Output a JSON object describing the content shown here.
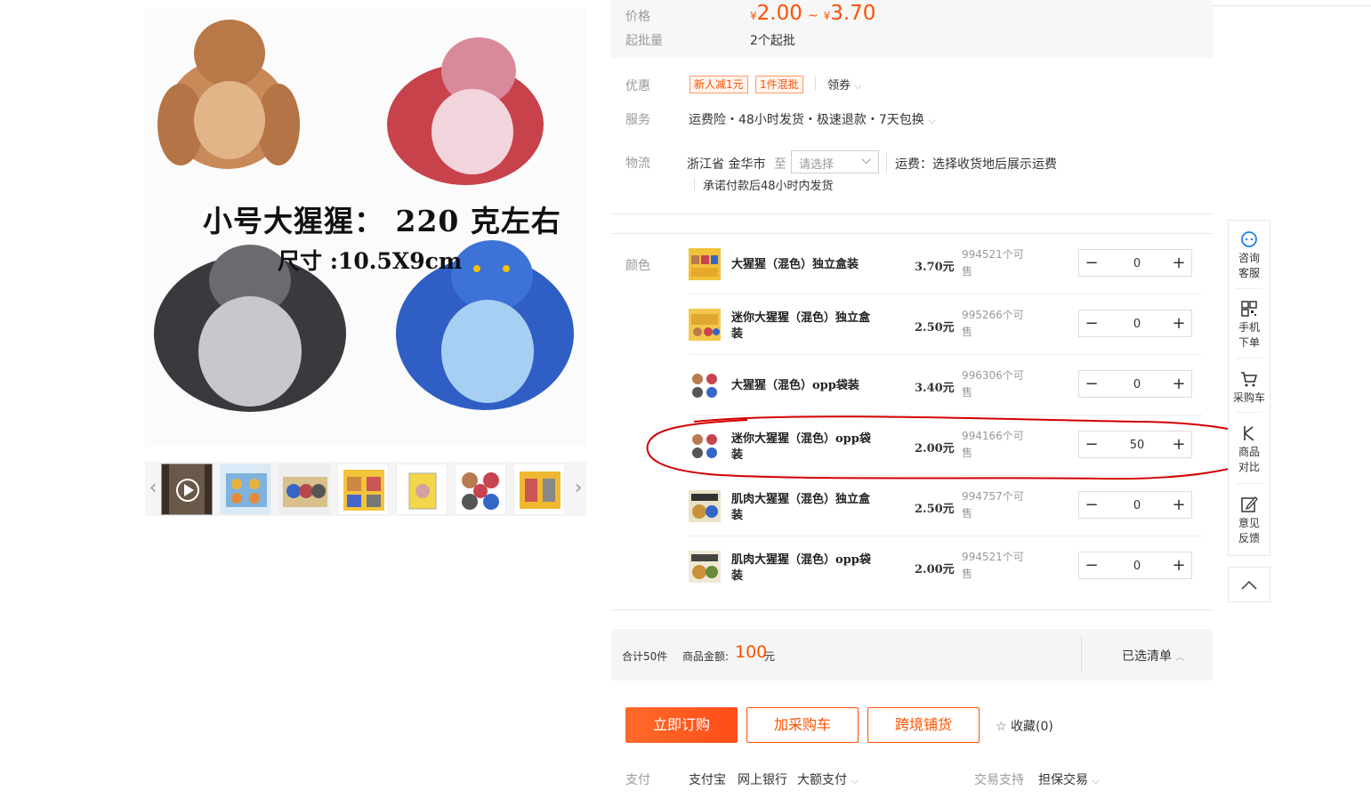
{
  "image": {
    "caption_line1": "小号大猩猩： 220 克左右",
    "caption_line2": "尺寸 :10.5X9cm"
  },
  "price": {
    "label": "价格",
    "currency": "¥",
    "min": "2.00",
    "tilde": "~",
    "max": "3.70",
    "min_batch_label": "起批量",
    "min_batch": "2个起批"
  },
  "promo": {
    "label": "优惠",
    "tags": [
      "新人减1元",
      "1件混批"
    ],
    "coupon": "领券"
  },
  "service": {
    "label": "服务",
    "text": "运费险・48小时发货・极速退款・7天包换"
  },
  "logistics": {
    "label": "物流",
    "origin": "浙江省 金华市",
    "to": "至",
    "select_placeholder": "请选择",
    "freight": "运费：选择收货地后展示运费",
    "promise": "承诺付款后48小时内发货"
  },
  "sku": {
    "label": "颜色",
    "rows": [
      {
        "name": "大猩猩（混色）独立盒装",
        "price": "3.70元",
        "stock": "994521个可售",
        "qty": "0"
      },
      {
        "name": "迷你大猩猩（混色）独立盒装",
        "price": "2.50元",
        "stock": "995266个可售",
        "qty": "0"
      },
      {
        "name": "大猩猩（混色）opp袋装",
        "price": "3.40元",
        "stock": "996306个可售",
        "qty": "0"
      },
      {
        "name": "迷你大猩猩（混色）opp袋装",
        "price": "2.00元",
        "stock": "994166个可售",
        "qty": "50"
      },
      {
        "name": "肌肉大猩猩（混色）独立盒装",
        "price": "2.50元",
        "stock": "994757个可售",
        "qty": "0"
      },
      {
        "name": "肌肉大猩猩（混色）opp袋装",
        "price": "2.00元",
        "stock": "994521个可售",
        "qty": "0"
      }
    ]
  },
  "summary": {
    "total": "合计50件",
    "amount_label": "商品金额:",
    "amount": "100",
    "amount_unit": "元",
    "selected_list": "已选清单"
  },
  "actions": {
    "buy_now": "立即订购",
    "add_cart": "加采购车",
    "cross_border": "跨境铺货",
    "favorite": "收藏(0)"
  },
  "payment": {
    "label": "支付",
    "methods": [
      "支付宝",
      "网上银行",
      "大额支付"
    ],
    "trade_label": "交易支持",
    "trade": "担保交易"
  },
  "sidebar": {
    "consult": "咨询客服",
    "mobile": "手机下单",
    "cart": "采购车",
    "compare": "商品对比",
    "feedback": "意见反馈"
  },
  "colors": {
    "accent": "#ff5000",
    "annotation": "#d40000"
  }
}
